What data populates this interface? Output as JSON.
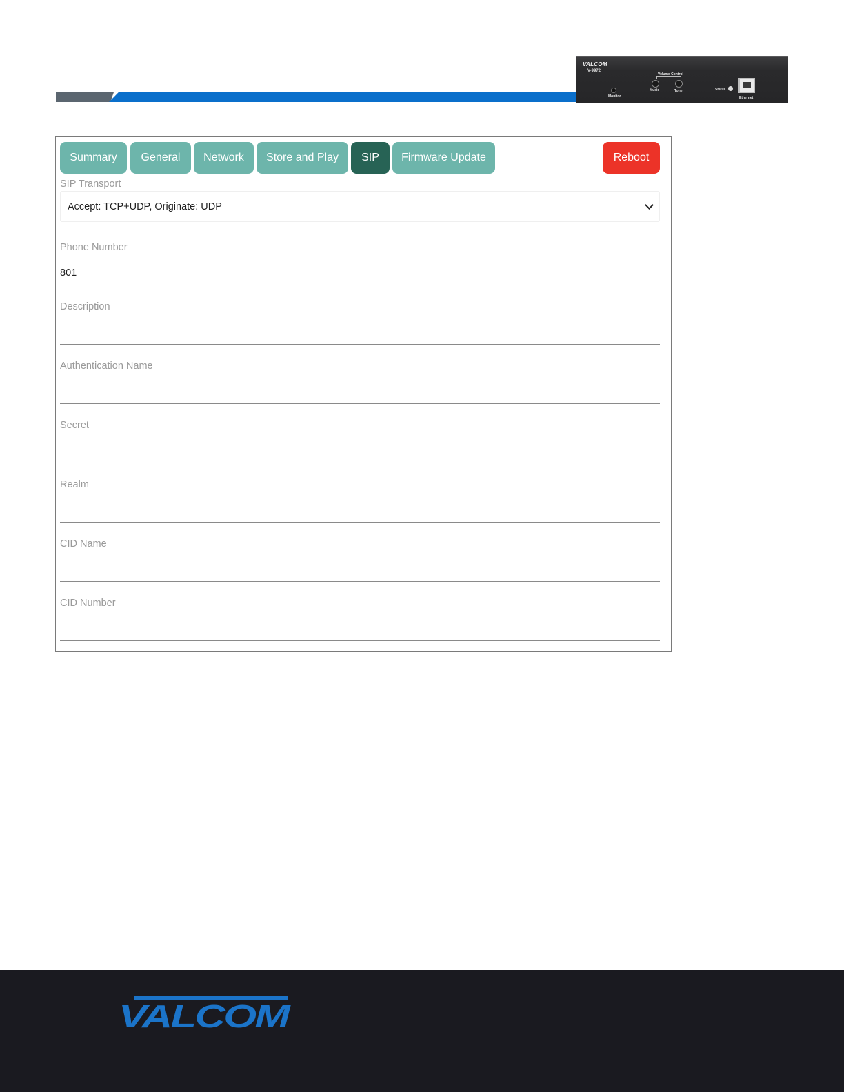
{
  "header": {
    "device": {
      "brand": "VALCOM",
      "model": "V-9972",
      "labels": {
        "volume_control": "Volume Control",
        "music": "Music",
        "tone": "Tone",
        "monitor": "Monitor",
        "status": "Status",
        "ethernet": "Ethernet"
      }
    }
  },
  "tabs": [
    {
      "label": "Summary",
      "active": false
    },
    {
      "label": "General",
      "active": false
    },
    {
      "label": "Network",
      "active": false
    },
    {
      "label": "Store and Play",
      "active": false
    },
    {
      "label": "SIP",
      "active": true
    },
    {
      "label": "Firmware Update",
      "active": false
    }
  ],
  "reboot_label": "Reboot",
  "form": {
    "sip_transport": {
      "label": "SIP Transport",
      "value": "Accept: TCP+UDP, Originate: UDP"
    },
    "phone_number": {
      "label": "Phone Number",
      "value": "801"
    },
    "description": {
      "label": "Description",
      "value": ""
    },
    "authentication_name": {
      "label": "Authentication Name",
      "value": ""
    },
    "secret": {
      "label": "Secret",
      "value": ""
    },
    "realm": {
      "label": "Realm",
      "value": ""
    },
    "cid_name": {
      "label": "CID Name",
      "value": ""
    },
    "cid_number": {
      "label": "CID Number",
      "value": ""
    }
  },
  "footer": {
    "logo_text": "VALCOM"
  },
  "colors": {
    "tab": "#6db5ab",
    "tab_active": "#276355",
    "reboot": "#ec3328",
    "band_blue": "#0a6fcb",
    "footer_bg": "#1a1a20",
    "logo_blue": "#1b74c9"
  }
}
